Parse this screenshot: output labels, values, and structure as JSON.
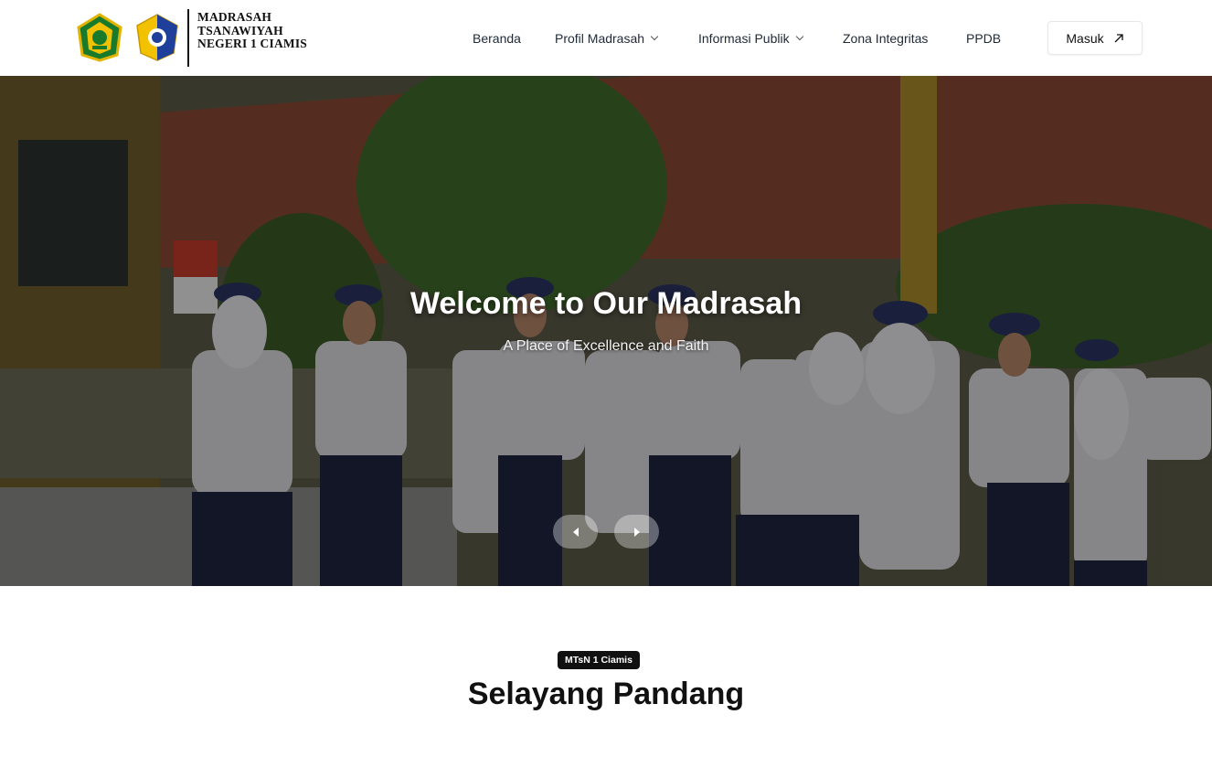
{
  "header": {
    "brand_lines": [
      "MADRASAH",
      "TSANAWIYAH",
      "NEGERI 1 CIAMIS"
    ],
    "logos": [
      "kemenag-logo",
      "madrasah-crest-logo"
    ]
  },
  "nav": {
    "items": [
      {
        "label": "Beranda",
        "dropdown": false
      },
      {
        "label": "Profil Madrasah",
        "dropdown": true
      },
      {
        "label": "Informasi Publik",
        "dropdown": true
      },
      {
        "label": "Zona Integritas",
        "dropdown": false
      },
      {
        "label": "PPDB",
        "dropdown": false
      }
    ],
    "login_label": "Masuk",
    "login_icon": "arrow-up-right-icon"
  },
  "hero": {
    "title": "Welcome to Our Madrasah",
    "subtitle": "A Place of Excellence and Faith",
    "prev_icon": "chevron-left-icon",
    "next_icon": "chevron-right-icon"
  },
  "section": {
    "badge": "MTsN 1 Ciamis",
    "title": "Selayang Pandang"
  },
  "colors": {
    "brand_dark": "#111111",
    "kemenag_green": "#1a7a2c",
    "crest_yellow": "#f2c200",
    "crest_blue": "#1e3f9a"
  }
}
